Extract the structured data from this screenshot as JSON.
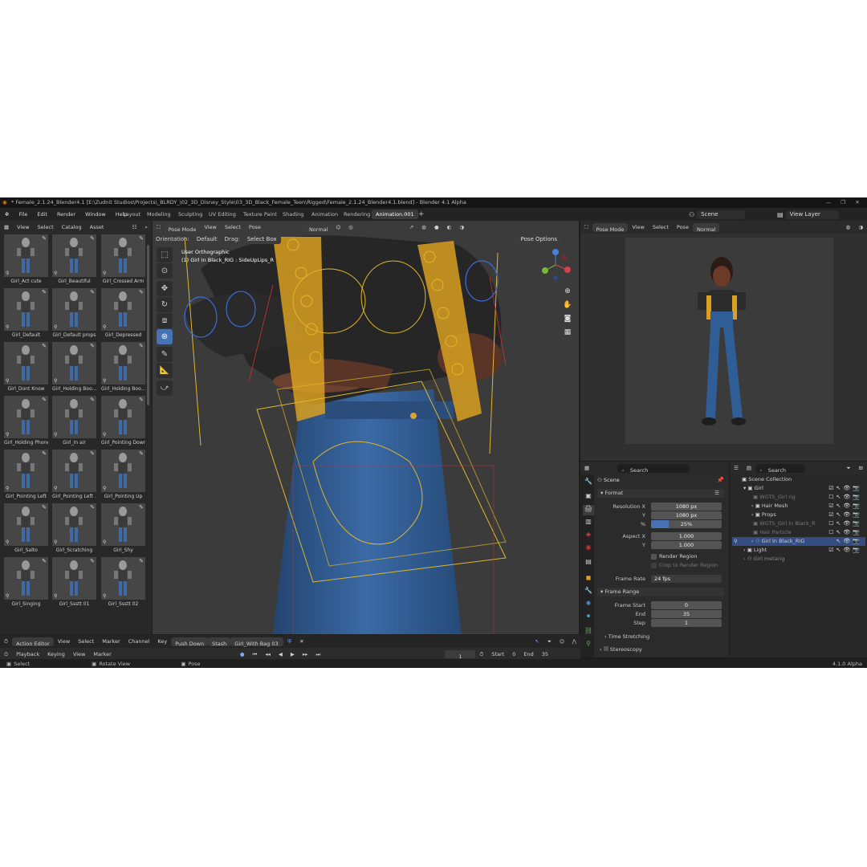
{
  "window": {
    "title": "* Female_2.1.24_Blender4.1 [E:\\Zudnit Studios\\Projects\\_BLRDY_\\02_3D_Disney_Style\\03_3D_Black_Female_Teen\\Rigged\\Female_2.1.24_Blender4.1.blend] - Blender 4.1 Alpha",
    "minimize": "—",
    "maximize": "❐",
    "close": "✕"
  },
  "menu": [
    "File",
    "Edit",
    "Render",
    "Window",
    "Help"
  ],
  "workspaces": [
    "Layout",
    "Modeling",
    "Sculpting",
    "UV Editing",
    "Texture Paint",
    "Shading",
    "Animation",
    "Rendering",
    "Animation.001"
  ],
  "add_workspace": "+",
  "scene_selector": "Scene",
  "view_layer_selector": "View Layer",
  "asset_browser": {
    "menu": [
      "View",
      "Select",
      "Catalog",
      "Asset"
    ],
    "items": [
      "Girl_Act cute",
      "Girl_Beautiful",
      "Girl_Crossed Arm",
      "Girl_Default",
      "Girl_Default props",
      "Girl_Depressed",
      "Girl_Dont Know",
      "Girl_Holding Boo...",
      "Girl_Holding Boo...",
      "Girl_Holding Phone",
      "Girl_In air",
      "Girl_Pointing Down",
      "Girl_Pointing Left",
      "Girl_Pointing Left ...",
      "Girl_Pointing Up",
      "Girl_Salto",
      "Girl_Scratching",
      "Girl_Shy",
      "Girl_Singing",
      "Girl_Ssstt 01",
      "Girl_Ssstt 02"
    ]
  },
  "viewport": {
    "mode": "Pose Mode",
    "menu": [
      "View",
      "Select",
      "Pose"
    ],
    "orientation_label": "Orientation:",
    "orientation": "Default",
    "drag_label": "Drag:",
    "drag": "Select Box",
    "pivot": "Normal",
    "pose_options": "Pose Options",
    "overlay_line1": "User Orthographic",
    "overlay_line2": "(1) Girl In Black_RIG : SideUpLips_R"
  },
  "preview_viewport": {
    "mode": "Pose Mode",
    "menu": [
      "View",
      "Select",
      "Pose"
    ],
    "pivot": "Normal"
  },
  "properties": {
    "search_placeholder": "Search",
    "breadcrumb": "Scene",
    "format_panel": "Format",
    "resolution_x_label": "Resolution X",
    "resolution_x": "1080 px",
    "y_label": "Y",
    "resolution_y": "1080 px",
    "percent_label": "%",
    "percent": "25%",
    "percent_value": 0.25,
    "aspect_x_label": "Aspect X",
    "aspect_x": "1.000",
    "aspect_y_label": "Y",
    "aspect_y": "1.000",
    "render_region": "Render Region",
    "crop_region": "Crop to Render Region",
    "frame_rate_label": "Frame Rate",
    "frame_rate": "24 fps",
    "frame_range_panel": "Frame Range",
    "frame_start_label": "Frame Start",
    "frame_start": "0",
    "end_label": "End",
    "end": "35",
    "step_label": "Step",
    "step": "1",
    "time_stretching": "Time Stretching",
    "stereoscopy": "Stereoscopy"
  },
  "outliner": {
    "search_placeholder": "Search",
    "items": [
      "Scene Collection",
      "Girl",
      "WGTS_Girl rig",
      "Hair Mesh",
      "Props",
      "WGTS_Girl In Black_R",
      "Hair Particle",
      "Girl In Black_RIG",
      "Light",
      "Girl.metarig"
    ]
  },
  "action_editor": {
    "mode": "Action Editor",
    "menu": [
      "View",
      "Select",
      "Marker",
      "Channel",
      "Key"
    ],
    "push_down": "Push Down",
    "stash": "Stash",
    "action": "Girl_With Bag 03"
  },
  "timeline": {
    "menu": [
      "Playback",
      "Keying",
      "View",
      "Marker"
    ],
    "current_frame": "1",
    "start_label": "Start",
    "start": "0",
    "end_label": "End",
    "end": "35"
  },
  "statusbar": {
    "select": "Select",
    "rotate": "Rotate View",
    "pose": "Pose",
    "version": "4.1.0 Alpha"
  }
}
